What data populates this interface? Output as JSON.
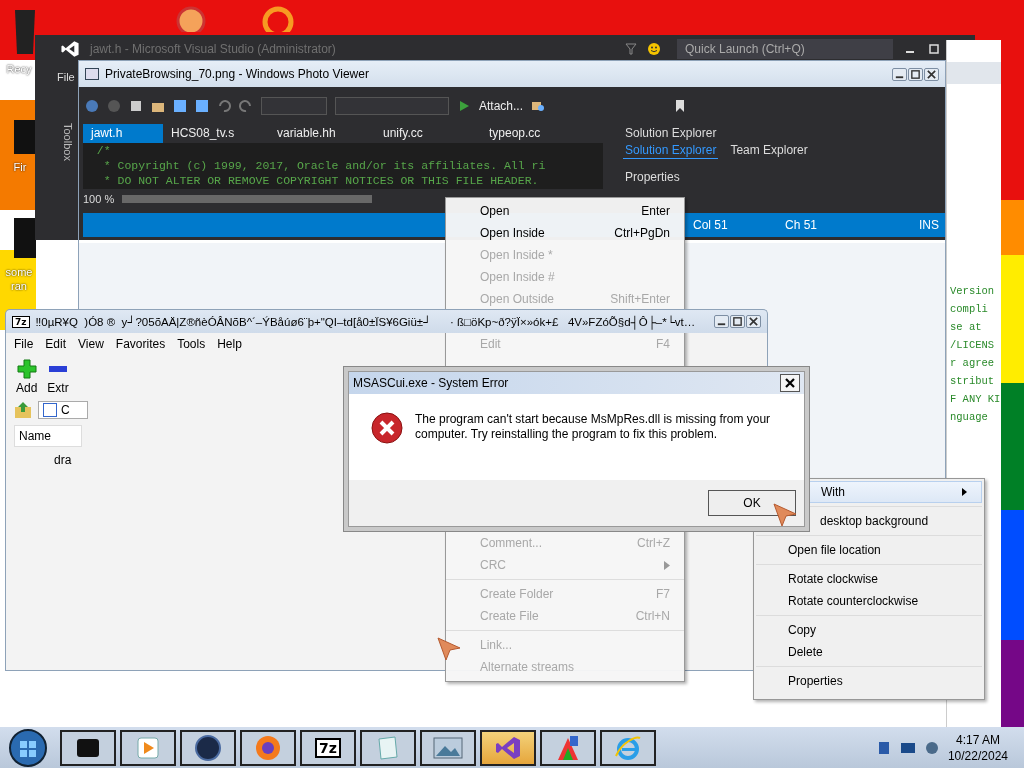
{
  "desktop": {
    "icons": [
      {
        "label": "Recy"
      },
      {
        "label": "Fir"
      },
      {
        "label": "some ran"
      }
    ]
  },
  "vs_window": {
    "title": "jawt.h - Microsoft Visual Studio (Administrator)",
    "quick_launch": "Quick Launch (Ctrl+Q)",
    "menu": [
      "File"
    ],
    "attach": "Attach...",
    "toolbox": "Toolbox",
    "tabs": [
      {
        "label": "jawt.h",
        "selected": true
      },
      {
        "label": "HCS08_tv.s",
        "selected": false
      },
      {
        "label": "variable.hh",
        "selected": false
      },
      {
        "label": "unify.cc",
        "selected": false
      },
      {
        "label": "typeop.cc",
        "selected": false
      }
    ],
    "code_lines": [
      "  /*",
      "   * Copyright (c) 1999, 2017, Oracle and/or its affiliates. All ri",
      "   * DO NOT ALTER OR REMOVE COPYRIGHT NOTICES OR THIS FILE HEADER."
    ],
    "zoom": "100 %",
    "solution_explorer": "Solution Explorer",
    "panel_tabs": [
      {
        "label": "Solution Explorer",
        "selected": true
      },
      {
        "label": "Team Explorer",
        "selected": false
      }
    ],
    "properties": "Properties",
    "status": [
      "Col 51",
      "Ch 51",
      "INS"
    ]
  },
  "photo_viewer": {
    "title": "PrivateBrowsing_70.png - Windows Photo Viewer"
  },
  "code_window": {
    "lines": [
      "Version",
      "compli",
      "se at",
      "/LICENS",
      "r agree",
      "stribut",
      "F ANY KI",
      "nguage"
    ]
  },
  "archiver": {
    "logo": "7z",
    "title_parts": [
      "‼0µR¥Q  )Ó8 ®  y┘?05õAÄ|Z®ñèÓÂNõB^´–ÝBåúø6¨þ+\"QI–td[å0±ÏS¥6Giü±┘",
      "· ß□öKp~ð?ÿÏ×»ók+£   4V»FZóÕ§d┤Ô├–*└vt…"
    ],
    "menu": [
      "File",
      "Edit",
      "View",
      "Favorites",
      "Tools",
      "Help"
    ],
    "toolbar": [
      "Add",
      "Extr"
    ],
    "path": "C",
    "column": "Name",
    "rows": [
      "dra"
    ]
  },
  "archive_menu": {
    "top_groups": [
      [
        {
          "label": "Open",
          "shortcut": "Enter",
          "disabled": false
        },
        {
          "label": "Open Inside",
          "shortcut": "Ctrl+PgDn",
          "disabled": false
        },
        {
          "label": "Open Inside *",
          "disabled": true
        },
        {
          "label": "Open Inside #",
          "disabled": true
        },
        {
          "label": "Open Outside",
          "shortcut": "Shift+Enter",
          "disabled": true
        }
      ],
      [
        {
          "label": "Edit",
          "shortcut": "F4",
          "disabled": true
        }
      ]
    ],
    "bottom_groups": [
      [
        {
          "label": "Comment...",
          "shortcut": "Ctrl+Z",
          "disabled": true
        },
        {
          "label": "CRC",
          "submenu": true,
          "disabled": true
        }
      ],
      [
        {
          "label": "Create Folder",
          "shortcut": "F7",
          "disabled": true
        },
        {
          "label": "Create File",
          "shortcut": "Ctrl+N",
          "disabled": true
        }
      ],
      [
        {
          "label": "Link...",
          "disabled": true
        },
        {
          "label": "Alternate streams",
          "disabled": true
        }
      ]
    ]
  },
  "error_dialog": {
    "title": "MSASCui.exe - System Error",
    "message": "The program can't start because MsMpRes.dll is missing from your computer. Try reinstalling the program to fix this problem.",
    "button": "OK"
  },
  "photo_menu": {
    "groups": [
      [
        {
          "label": "With",
          "submenu": true,
          "selected": true
        }
      ],
      [
        {
          "label": "desktop background",
          "selected": false
        }
      ],
      [
        {
          "label": "Open file location",
          "selected": false
        }
      ],
      [
        {
          "label": "Rotate clockwise",
          "selected": false
        },
        {
          "label": "Rotate counterclockwise",
          "selected": false
        }
      ],
      [
        {
          "label": "Copy",
          "selected": false
        },
        {
          "label": "Delete",
          "selected": false
        }
      ],
      [
        {
          "label": "Properties",
          "selected": false
        }
      ]
    ]
  },
  "taskbar": {
    "apps": [
      {
        "kind": "box",
        "selected": false
      },
      {
        "kind": "media",
        "selected": false
      },
      {
        "kind": "globe",
        "selected": false
      },
      {
        "kind": "fox",
        "selected": false
      },
      {
        "kind": "sevenzip",
        "label": "7z",
        "selected": false
      },
      {
        "kind": "note",
        "selected": false
      },
      {
        "kind": "photo",
        "selected": false
      },
      {
        "kind": "vs",
        "selected": true
      },
      {
        "kind": "paint",
        "selected": false
      },
      {
        "kind": "ie",
        "selected": false
      }
    ],
    "clock": {
      "time": "4:17 AM",
      "date": "10/22/2024"
    }
  }
}
